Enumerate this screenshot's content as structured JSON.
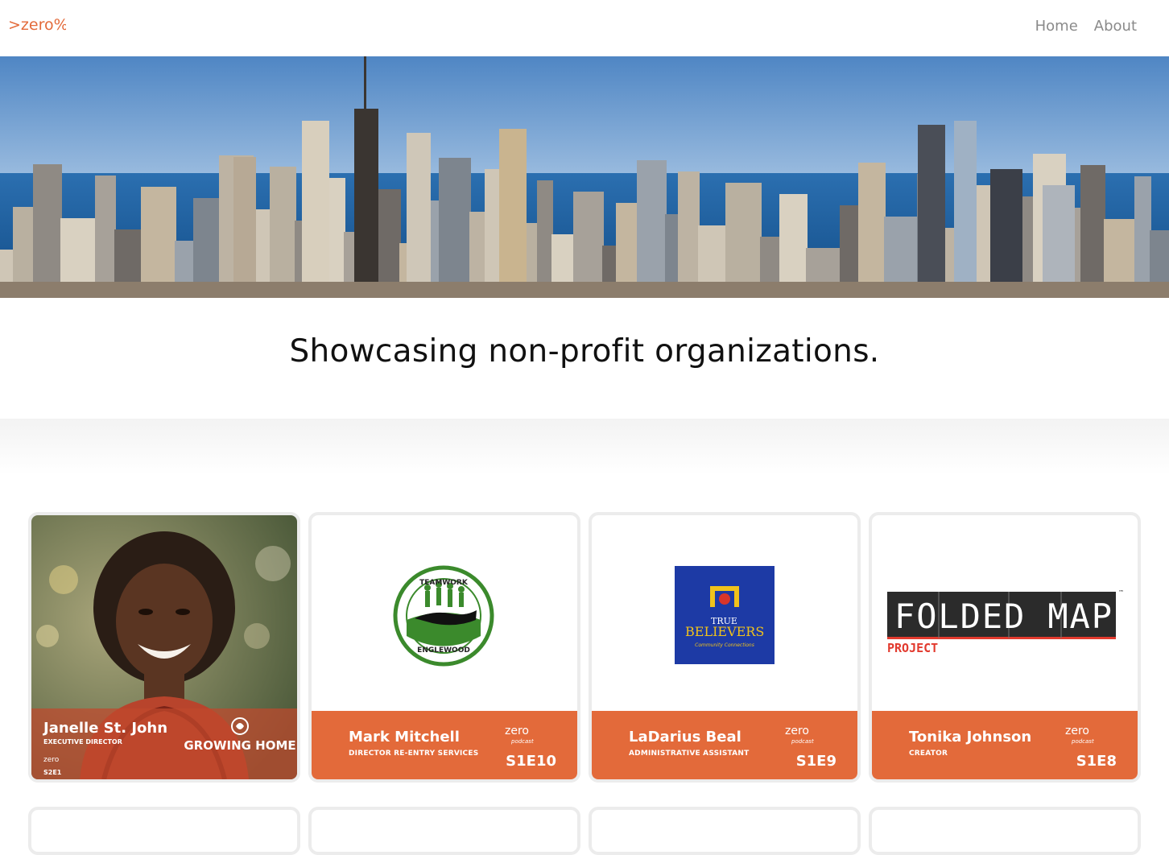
{
  "nav": {
    "logo_text": ">zero%",
    "links": [
      "Home",
      "About"
    ]
  },
  "hero": {
    "tagline": "Showcasing non-profit organizations."
  },
  "colors": {
    "brand_orange": "#e36a3a",
    "nav_gray": "#8a8a8a"
  },
  "cards": [
    {
      "name": "Janelle St. John",
      "role": "EXECUTIVE DIRECTOR",
      "episode": "S2E1",
      "org": "GROWING HOME",
      "logo_brand": "zero"
    },
    {
      "name": "Mark Mitchell",
      "role": "DIRECTOR RE-ENTRY SERVICES",
      "episode": "S1E10",
      "org_top": "TEAMWORK",
      "org_bottom": "ENGLEWOOD",
      "logo_brand": "zero",
      "logo_sub": "podcast"
    },
    {
      "name": "LaDarius Beal",
      "role": "ADMINISTRATIVE ASSISTANT",
      "episode": "S1E9",
      "org_top": "TRUE",
      "org_main": "BELIEVERS",
      "org_sub": "Community Connections",
      "logo_brand": "zero",
      "logo_sub": "podcast"
    },
    {
      "name": "Tonika Johnson",
      "role": "CREATOR",
      "episode": "S1E8",
      "org_main": "FOLDED MAP",
      "org_sub": "PROJECT",
      "org_tm": "™",
      "logo_brand": "zero",
      "logo_sub": "podcast"
    }
  ]
}
